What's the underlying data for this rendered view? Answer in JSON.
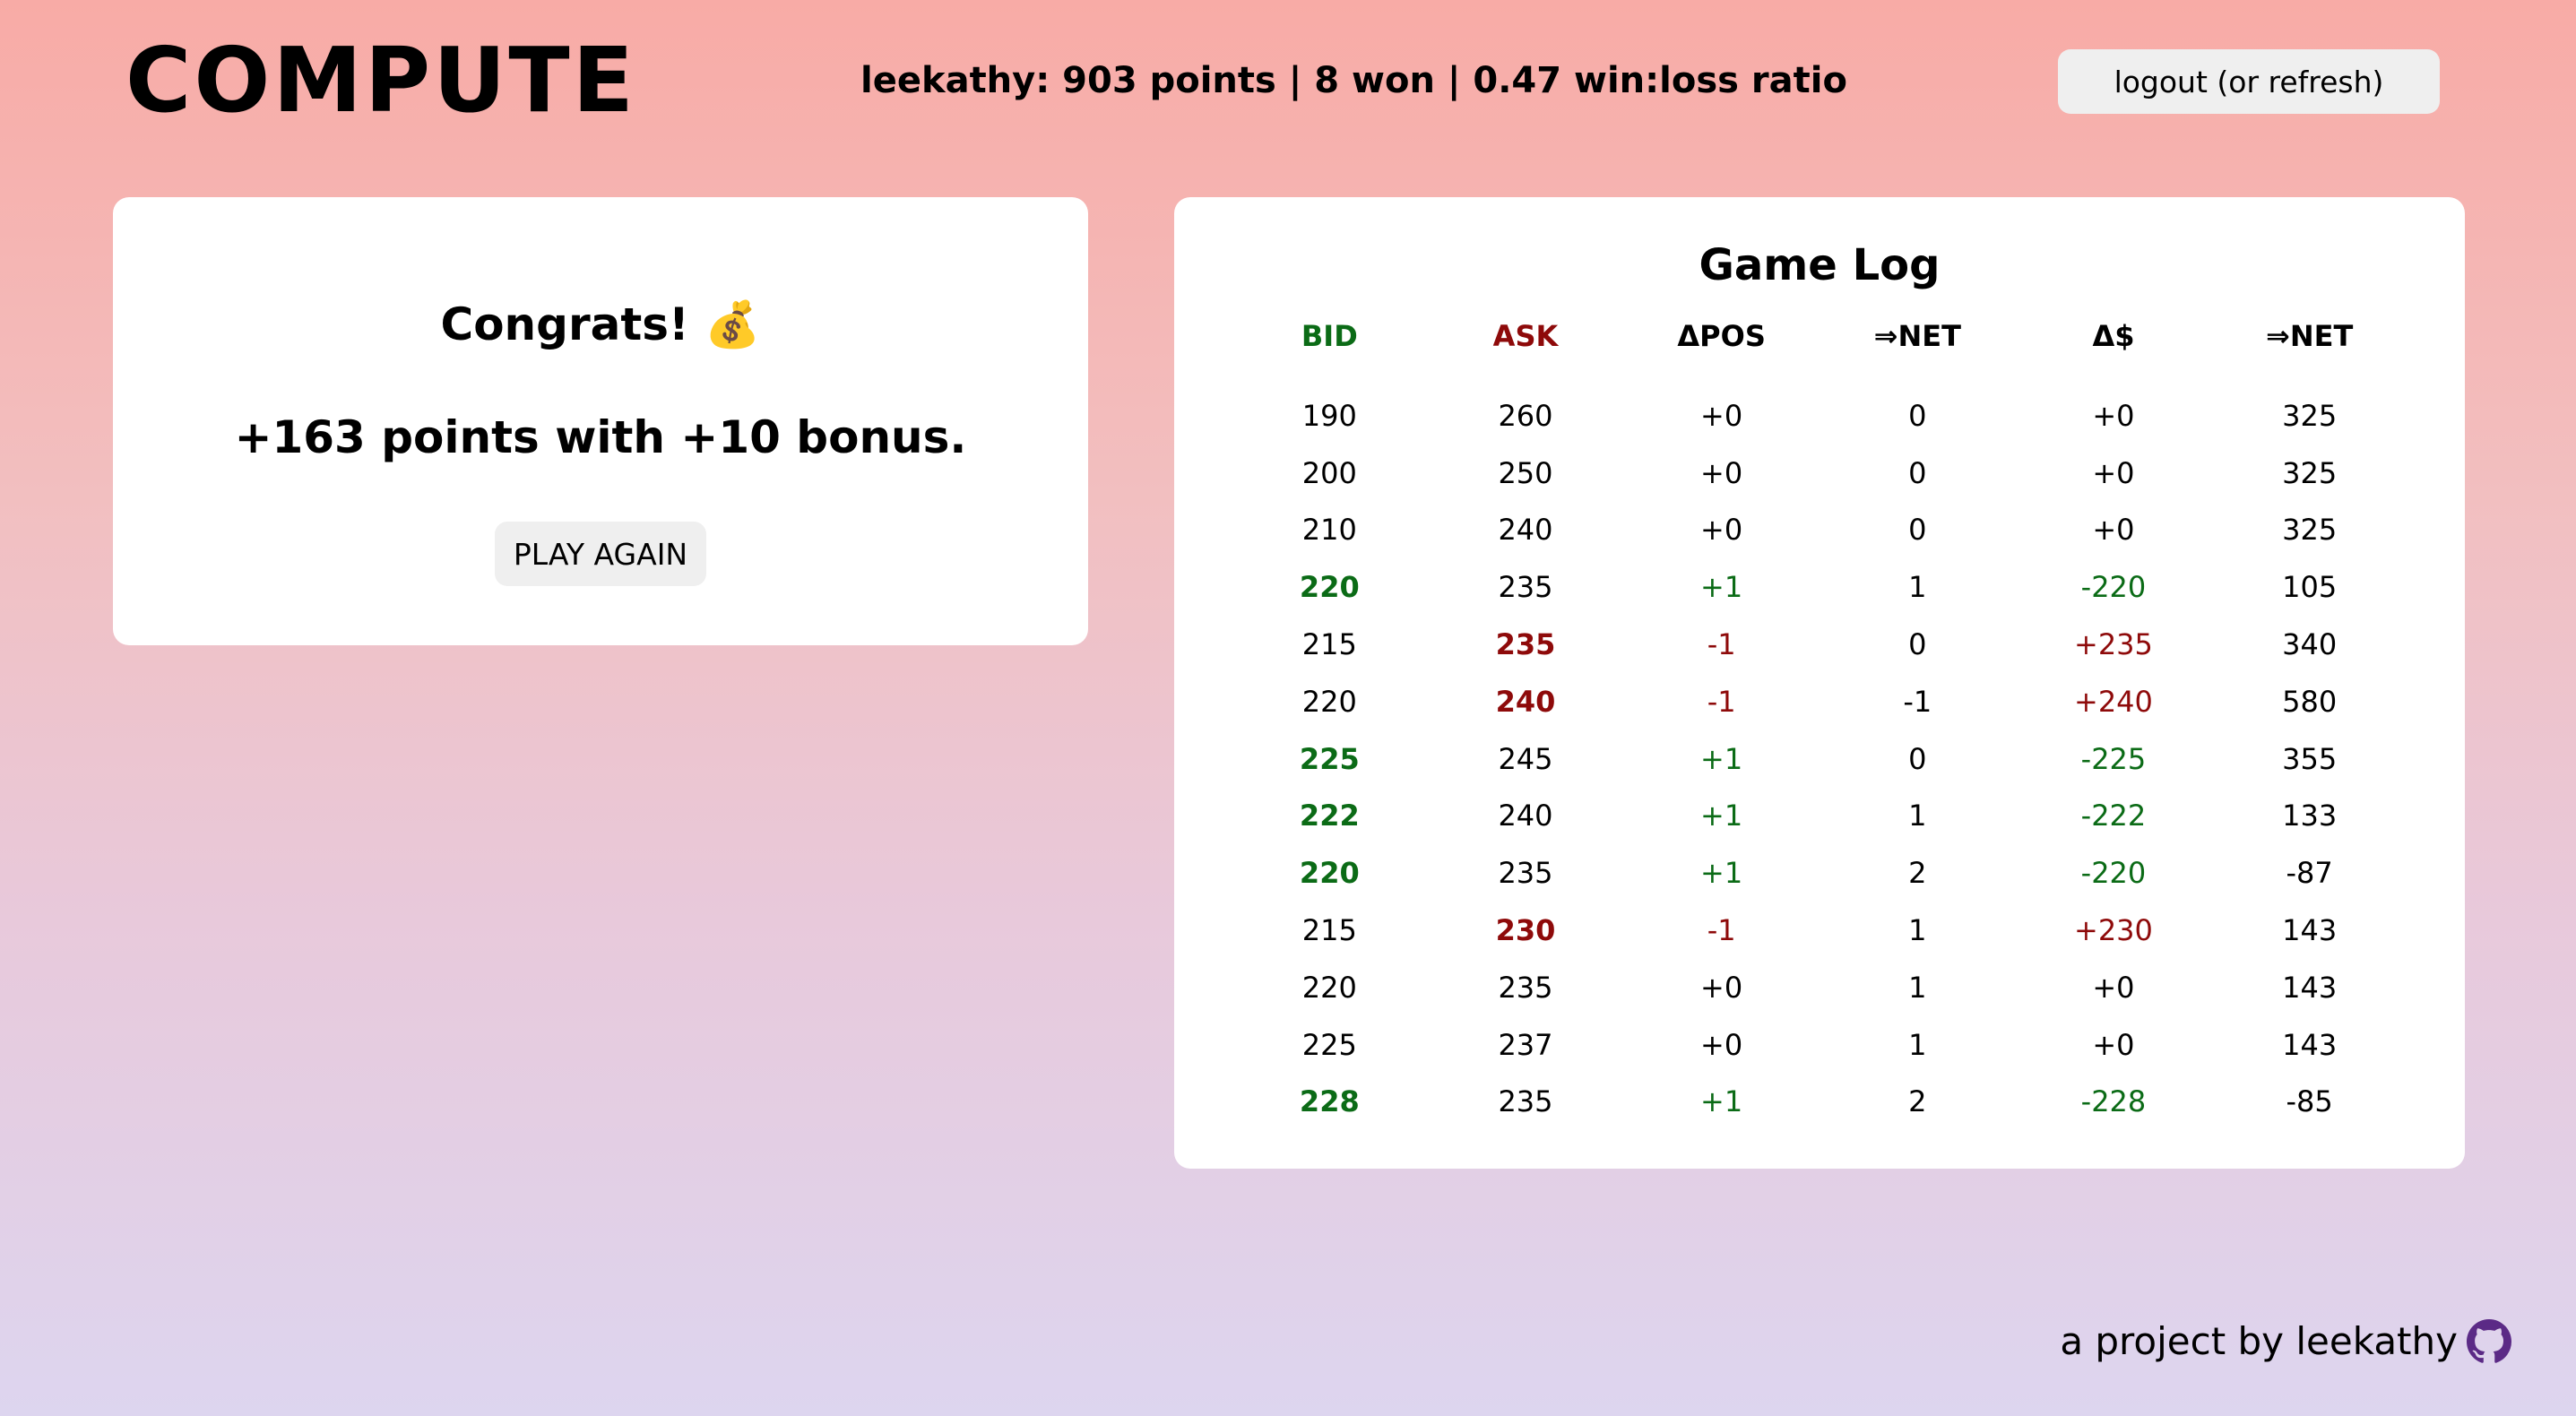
{
  "header": {
    "title": "COMPUTE",
    "stats": "leekathy: 903 points | 8 won | 0.47 win:loss ratio",
    "logout_label": "logout (or refresh)"
  },
  "result": {
    "congrats": "Congrats! 💰",
    "points": "+163 points with +10 bonus.",
    "play_again_label": "PLAY AGAIN"
  },
  "log": {
    "title": "Game Log",
    "columns": [
      "BID",
      "ASK",
      "ΔPOS",
      "⇒NET",
      "Δ$",
      "⇒NET"
    ],
    "rows": [
      {
        "bid": "190",
        "ask": "260",
        "dpos": "+0",
        "net_pos": "0",
        "dcash": "+0",
        "net_cash": "325",
        "action": "none"
      },
      {
        "bid": "200",
        "ask": "250",
        "dpos": "+0",
        "net_pos": "0",
        "dcash": "+0",
        "net_cash": "325",
        "action": "none"
      },
      {
        "bid": "210",
        "ask": "240",
        "dpos": "+0",
        "net_pos": "0",
        "dcash": "+0",
        "net_cash": "325",
        "action": "none"
      },
      {
        "bid": "220",
        "ask": "235",
        "dpos": "+1",
        "net_pos": "1",
        "dcash": "-220",
        "net_cash": "105",
        "action": "buy"
      },
      {
        "bid": "215",
        "ask": "235",
        "dpos": "-1",
        "net_pos": "0",
        "dcash": "+235",
        "net_cash": "340",
        "action": "sell"
      },
      {
        "bid": "220",
        "ask": "240",
        "dpos": "-1",
        "net_pos": "-1",
        "dcash": "+240",
        "net_cash": "580",
        "action": "sell"
      },
      {
        "bid": "225",
        "ask": "245",
        "dpos": "+1",
        "net_pos": "0",
        "dcash": "-225",
        "net_cash": "355",
        "action": "buy"
      },
      {
        "bid": "222",
        "ask": "240",
        "dpos": "+1",
        "net_pos": "1",
        "dcash": "-222",
        "net_cash": "133",
        "action": "buy"
      },
      {
        "bid": "220",
        "ask": "235",
        "dpos": "+1",
        "net_pos": "2",
        "dcash": "-220",
        "net_cash": "-87",
        "action": "buy"
      },
      {
        "bid": "215",
        "ask": "230",
        "dpos": "-1",
        "net_pos": "1",
        "dcash": "+230",
        "net_cash": "143",
        "action": "sell"
      },
      {
        "bid": "220",
        "ask": "235",
        "dpos": "+0",
        "net_pos": "1",
        "dcash": "+0",
        "net_cash": "143",
        "action": "none"
      },
      {
        "bid": "225",
        "ask": "237",
        "dpos": "+0",
        "net_pos": "1",
        "dcash": "+0",
        "net_cash": "143",
        "action": "none"
      },
      {
        "bid": "228",
        "ask": "235",
        "dpos": "+1",
        "net_pos": "2",
        "dcash": "-228",
        "net_cash": "-85",
        "action": "buy"
      }
    ]
  },
  "footer": {
    "credit": "a project by leekathy",
    "icon": "github-icon"
  },
  "colors": {
    "buy": "#0b6b16",
    "sell": "#8e0a0a",
    "icon": "#5b2a86"
  }
}
